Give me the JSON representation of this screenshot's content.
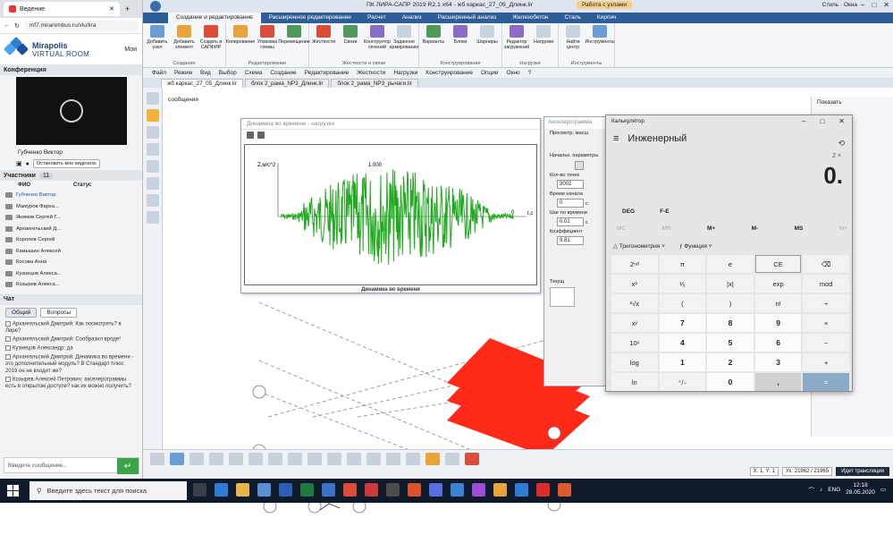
{
  "browser": {
    "tab_title": "Ведение",
    "url": "mf7.miranimbus.ru/vlu/lira",
    "brand_top": "Mirapolis",
    "brand_bottom": "VIRTUAL ROOM",
    "brand_side": "Мои"
  },
  "conference": {
    "header": "Конференция",
    "speaker_name": "Губченко Виктор",
    "stop_video_label": "Остановить мое видеоизо"
  },
  "participants": {
    "header": "Участники",
    "count": "11",
    "col_fio": "ФИО",
    "col_status": "Статус",
    "items": [
      "Губченко Виктор",
      "Мамуров Фарха...",
      "Якимов Сергей Г...",
      "Архангельский Д...",
      "Королев Сергей",
      "Камышин Алексей",
      "Косова Анна",
      "Кузнецов Алекса...",
      "Козырев Алекса..."
    ]
  },
  "chat": {
    "header": "Чат",
    "tab_all": "Общий",
    "tab_questions": "Вопросы",
    "messages": [
      "Архангельский Дмитрий: Как посмотреть? в Лире?",
      "Архангельский Дмитрий: Сообразил вроде!",
      "Кузнецов Александр: да",
      "Архангельский Дмитрий: Динамика во времени - это дополнительный модуль? В Стандарт плюс 2019 он не входит же?",
      "Козырев Алексей Петрович: акселерограммы есть в открытом доступе? как их можно получить?"
    ],
    "input_placeholder": "Введите сообщение...",
    "send_symbol": "↵"
  },
  "lira": {
    "title": "ПК ЛИРА-САПР 2019 R2.1 x64 - жб каркас_27_05_Длинк.lir",
    "work_badge": "Работа с узлами",
    "style_label": "Стиль · Окна",
    "menu_tabs": [
      "Создание и редактирование",
      "Расширенное редактирование",
      "Расчет",
      "Анализ",
      "Расширенный анализ",
      "Железобетон",
      "Сталь",
      "Кирпич"
    ],
    "ribbon_groups": [
      {
        "label": "Создание",
        "buttons": [
          "Добавить узел",
          "Добавить элемент",
          "Создать в САПФИР"
        ]
      },
      {
        "label": "Редактирование",
        "buttons": [
          "Копирование",
          "Упаковка схемы",
          "Перемещение"
        ]
      },
      {
        "label": "Жесткости и связи",
        "buttons": [
          "Жесткости",
          "Связи",
          "Конструктор сечений",
          "Заданное армирование"
        ]
      },
      {
        "label": "Конструирование",
        "buttons": [
          "Варианты",
          "Блоки",
          "Шарниры"
        ]
      },
      {
        "label": "Нагрузки",
        "buttons": [
          "Редактор загружений",
          "Нагрузки"
        ]
      },
      {
        "label": "Инструменты",
        "buttons": [
          "Найти центр",
          "Инструменты"
        ]
      }
    ],
    "menubar": [
      "Файл",
      "Режим",
      "Вид",
      "Выбор",
      "Схема",
      "Создание",
      "Редактирование",
      "Жесткости",
      "Нагрузки",
      "Конструирование",
      "Опции",
      "Окно",
      "?"
    ],
    "doc_tabs": [
      "жб каркас_27_05_Длинк.lir",
      "блок 2_рама_NP3_Длинк.lir",
      "блок 2_рама_NP3_рычаги.lir"
    ],
    "work_label": "сообщения",
    "status_axes": "X: 1, Y: 1",
    "status_dims": "Ух: 21962 / 21965",
    "status_mode": "Идет трансляция"
  },
  "graph_window": {
    "title": "Динамика во времени - нагрузки",
    "caption": "Динамика во времени",
    "y_label": "Z,м/с^2",
    "x_label": "t,с",
    "peak_label": "1.000",
    "zero_label": "0"
  },
  "accel_dialog": {
    "title": "Акселерограмма",
    "field_prev": "Просмотр, масш.",
    "field_start": "Начальн. параметры",
    "field_points": "Кол-во точек",
    "points_value": "3002",
    "field_time_start": "Время начала",
    "time_start_value": "0",
    "field_step": "Шаг по времени",
    "step_value": "0.01",
    "unit_s": "с",
    "field_coef": "Коэффициент",
    "coef_value": "9.81",
    "extra_label": "Текущ"
  },
  "calculator": {
    "title": "Калькулятор",
    "mode": "Инженерный",
    "expression": "2 ×",
    "display": "0.",
    "deg": "DEG",
    "fe": "F-E",
    "memory": [
      "MC",
      "MR",
      "M+",
      "M-",
      "MS",
      "M˅"
    ],
    "trig": "Тригонометрия",
    "func": "Функция",
    "keys": [
      "2ⁿᵈ",
      "π",
      "e",
      "CE",
      "⌫",
      "x²",
      "¹⁄ₓ",
      "|x|",
      "exp",
      "mod",
      "²√x",
      "(",
      ")",
      "n!",
      "÷",
      "xʸ",
      "7",
      "8",
      "9",
      "×",
      "10ˣ",
      "4",
      "5",
      "6",
      "−",
      "log",
      "1",
      "2",
      "3",
      "+",
      "ln",
      "⁺/₋",
      "0",
      ",",
      "="
    ]
  },
  "right_panel": {
    "header": "Показать"
  },
  "taskbar": {
    "search_placeholder": "Введите здесь текст для поиска",
    "lang": "ENG",
    "time": "12:18",
    "date": "28.05.2020"
  },
  "chart_data": {
    "type": "line",
    "title": "Динамика во времени",
    "ylabel": "Z,м/с^2",
    "xlabel": "t,с",
    "peak_annotation": "1.000",
    "series": [
      {
        "values": []
      }
    ],
    "note_shape": "acceleration record with envelope rising then decaying"
  },
  "colors": {
    "accent": "#2d5d99",
    "signal": "#1faa1f",
    "slab": "#ff2a1a"
  }
}
